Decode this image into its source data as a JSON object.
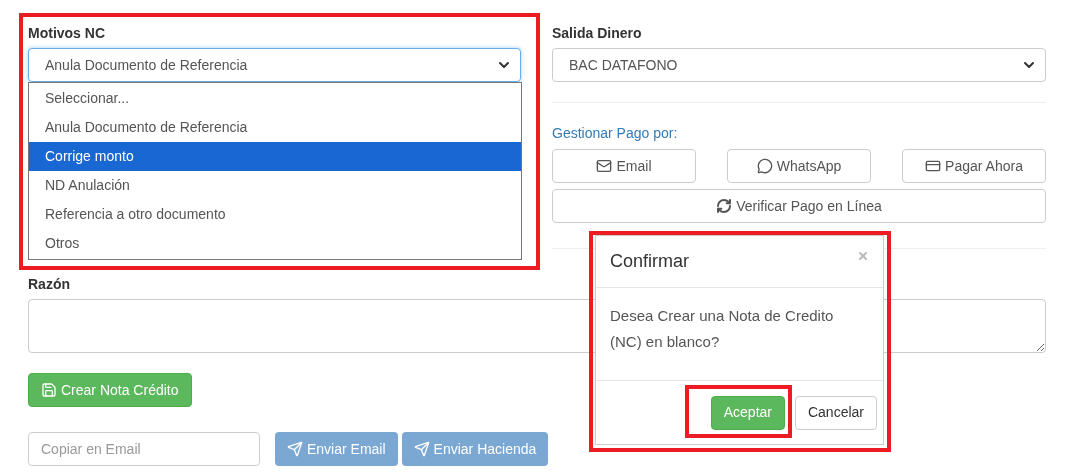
{
  "motivos": {
    "label": "Motivos NC",
    "value": "Anula Documento de Referencia",
    "expanded": true,
    "options": [
      {
        "label": "Seleccionar...",
        "highlighted": false
      },
      {
        "label": "Anula Documento de Referencia",
        "highlighted": false
      },
      {
        "label": "Corrige monto",
        "highlighted": true
      },
      {
        "label": "ND Anulación",
        "highlighted": false
      },
      {
        "label": "Referencia a otro documento",
        "highlighted": false
      },
      {
        "label": "Otros",
        "highlighted": false
      }
    ]
  },
  "salida": {
    "label": "Salida Dinero",
    "value": "BAC DATAFONO"
  },
  "gestionar": {
    "label": "Gestionar Pago por:",
    "buttons": [
      {
        "kind": "email",
        "label": "Email"
      },
      {
        "kind": "whatsapp",
        "label": "WhatsApp"
      },
      {
        "kind": "card",
        "label": "Pagar Ahora"
      }
    ],
    "verify": "Verificar Pago en Línea"
  },
  "razon": {
    "label": "Razón"
  },
  "create_button": "Crear Nota Crédito",
  "copy_email": {
    "placeholder": "Copiar en Email"
  },
  "send_buttons": [
    "Enviar Email",
    "Enviar Hacienda"
  ],
  "dialog": {
    "title": "Confirmar",
    "message": "Desea Crear una Nota de Credito (NC) en blanco?",
    "buttons": [
      {
        "label": "Aceptar",
        "kind": "primary"
      },
      {
        "label": "Cancelar",
        "kind": "default"
      }
    ]
  }
}
